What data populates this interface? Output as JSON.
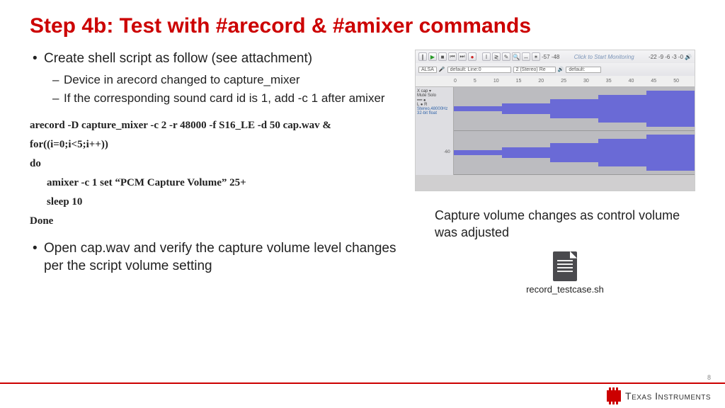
{
  "title": "Step 4b: Test with #arecord & #amixer commands",
  "bullet1": "Create shell script as follow (see attachment)",
  "sub1": "Device in arecord changed to capture_mixer",
  "sub2": "If the corresponding sound card id is 1, add -c 1 after amixer",
  "code": {
    "l1": "arecord -D capture_mixer -c 2 -r 48000 -f S16_LE -d 50 cap.wav &",
    "l2": "for((i=0;i<5;i++))",
    "l3": "do",
    "l4": "amixer -c 1 set “PCM Capture Volume”  25+",
    "l5": "sleep 10",
    "l6": "Done"
  },
  "bullet2": "Open cap.wav and verify the capture volume level changes per the script volume setting",
  "audacity": {
    "alsa": "ALSA",
    "dev1": "default: Line:0",
    "dev2": "2 (Stereo) Re",
    "dev3": "default:",
    "monitor": "Click to Start Monitoring",
    "meter1": "-57  -48",
    "meter2": "-22 -9 -6 -3 -0",
    "ruler": [
      "0",
      "5",
      "10",
      "15",
      "20",
      "25",
      "30",
      "35",
      "40",
      "45",
      "50"
    ],
    "axis": "-60"
  },
  "caption": "Capture volume changes as control volume was adjusted",
  "filename": "record_testcase.sh",
  "page": "8",
  "company": "Texas Instruments"
}
